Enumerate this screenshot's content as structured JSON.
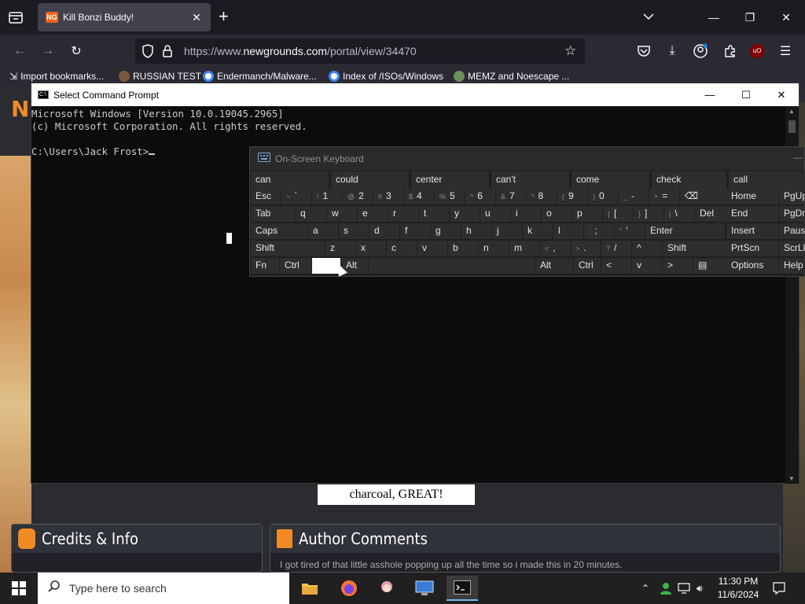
{
  "browser": {
    "tab_title": "Kill Bonzi Buddy!",
    "tab_favicon": "NG",
    "url_prefix": "https://www.",
    "url_domain": "newgrounds.com",
    "url_path": "/portal/view/34470",
    "ublock_label": "uO",
    "bookmarks": [
      "Import bookmarks...",
      "RUSSIAN TEST",
      "Endermanch/Malware...",
      "Index of /ISOs/Windows",
      "MEMZ and Noescape ..."
    ]
  },
  "page": {
    "logo": "N",
    "caption": "charcoal, GREAT!",
    "credits_title": "Credits & Info",
    "author_title": "Author Comments",
    "author_text": "I got tired of that little asshole popping up all the time so i made this in 20 minutes."
  },
  "cmd": {
    "title": "Select Command Prompt",
    "icon_text": "C:\\",
    "line1": "Microsoft Windows [Version 10.0.19045.2965]",
    "line2": "(c) Microsoft Corporation. All rights reserved.",
    "prompt": "C:\\Users\\Jack Frost>"
  },
  "osk": {
    "title": "On-Screen Keyboard",
    "predictions": [
      "can",
      "could",
      "center",
      "can't",
      "come",
      "check",
      "call"
    ],
    "row1": [
      {
        "main": "Esc"
      },
      {
        "sub": "~",
        "main": "`"
      },
      {
        "sub": "!",
        "main": "1"
      },
      {
        "sub": "@",
        "main": "2"
      },
      {
        "sub": "#",
        "main": "3"
      },
      {
        "sub": "$",
        "main": "4"
      },
      {
        "sub": "%",
        "main": "5"
      },
      {
        "sub": "^",
        "main": "6"
      },
      {
        "sub": "&",
        "main": "7"
      },
      {
        "sub": "*",
        "main": "8"
      },
      {
        "sub": "(",
        "main": "9"
      },
      {
        "sub": ")",
        "main": "0"
      },
      {
        "sub": "_",
        "main": "-"
      },
      {
        "sub": "+",
        "main": "="
      },
      {
        "main": "⌫"
      }
    ],
    "row2": [
      "Tab",
      "q",
      "w",
      "e",
      "r",
      "t",
      "y",
      "u",
      "i",
      "o",
      "p",
      "[",
      "]",
      "\\",
      "Del"
    ],
    "row2_sub": [
      "",
      "",
      "",
      "",
      "",
      "",
      "",
      "",
      "",
      "",
      "",
      "{",
      "}",
      "|",
      ""
    ],
    "row3": [
      "Caps",
      "a",
      "s",
      "d",
      "f",
      "g",
      "h",
      "j",
      "k",
      "l",
      ";",
      "'",
      "Enter"
    ],
    "row3_sub": [
      "",
      "",
      "",
      "",
      "",
      "",
      "",
      "",
      "",
      "",
      ":",
      "\"",
      ""
    ],
    "row4": [
      "Shift",
      "z",
      "x",
      "c",
      "v",
      "b",
      "n",
      "m",
      ",",
      ".",
      "/",
      "^",
      "Shift"
    ],
    "row4_sub": [
      "",
      "",
      "",
      "",
      "",
      "",
      "",
      "",
      "<",
      ">",
      "?",
      "",
      ""
    ],
    "row5": [
      "Fn",
      "Ctrl",
      "",
      "Alt",
      "",
      "Alt",
      "Ctrl",
      "<",
      "v",
      ">",
      "▤"
    ],
    "side": [
      [
        "Home",
        "PgUp"
      ],
      [
        "End",
        "PgDn"
      ],
      [
        "Insert",
        "Pause"
      ],
      [
        "PrtScn",
        "ScrLk"
      ],
      [
        "Options",
        "Help"
      ]
    ]
  },
  "taskbar": {
    "search_placeholder": "Type here to search",
    "time": "11:30 PM",
    "date": "11/6/2024"
  }
}
